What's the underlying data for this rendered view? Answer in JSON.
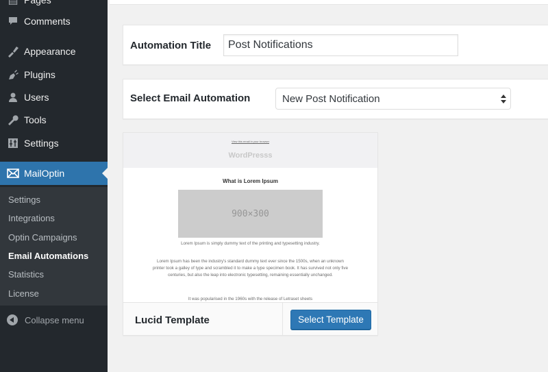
{
  "sidebar": {
    "items": [
      {
        "label": "Pages",
        "icon": "pages-icon"
      },
      {
        "label": "Comments",
        "icon": "comment-icon"
      },
      {
        "label": "Appearance",
        "icon": "paintbrush-icon"
      },
      {
        "label": "Plugins",
        "icon": "plug-icon"
      },
      {
        "label": "Users",
        "icon": "user-icon"
      },
      {
        "label": "Tools",
        "icon": "wrench-icon"
      },
      {
        "label": "Settings",
        "icon": "sliders-icon"
      }
    ],
    "active": {
      "label": "MailOptin",
      "icon": "envelope-icon"
    },
    "submenu": [
      {
        "label": "Settings"
      },
      {
        "label": "Integrations"
      },
      {
        "label": "Optin Campaigns"
      },
      {
        "label": "Email Automations",
        "current": true
      },
      {
        "label": "Statistics"
      },
      {
        "label": "License"
      }
    ],
    "collapse_label": "Collapse menu"
  },
  "automation_title": {
    "label": "Automation Title",
    "value": "Post Notifications"
  },
  "email_automation": {
    "label": "Select Email Automation",
    "selected": "New Post Notification"
  },
  "template": {
    "preview": {
      "view_link": "View this email in your browser",
      "brand": "WordPresss",
      "heading": "What is Lorem Ipsum",
      "image_placeholder": "900×300",
      "paragraph1": "Lorem Ipsum is simply dummy text of the printing and typesetting industry.",
      "paragraph2": "Lorem Ipsum has been the industry's standard dummy text ever since the 1500s, when an unknown printer took a galley of type and scrambled it to make a type specimen book. It has survived not only five centuries, but also the leap into electronic typesetting, remaining essentially unchanged.",
      "paragraph3": "It was popularised in the 1960s with the release of Letraset sheets"
    },
    "name": "Lucid Template",
    "button_label": "Select Template"
  }
}
